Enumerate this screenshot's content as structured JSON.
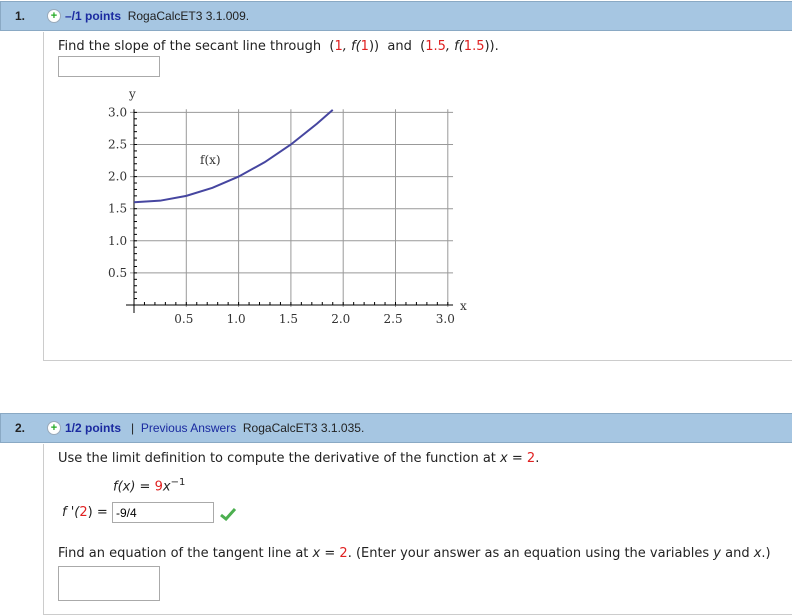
{
  "q1": {
    "number": "1.",
    "points": "–/1 points",
    "code": "RogaCalcET3 3.1.009.",
    "prompt": "Find the slope of the secant line through",
    "p1_open": "(",
    "p1_x": "1",
    "p1_mid": ", f(",
    "p1_arg": "1",
    "p1_close": "))",
    "and": "and",
    "p2_open": "(",
    "p2_x": "1.5",
    "p2_mid": ", f(",
    "p2_arg": "1.5",
    "p2_close": ")).",
    "answer": ""
  },
  "chart_data": {
    "type": "line",
    "title": "",
    "xlabel": "x",
    "ylabel": "y",
    "xlim": [
      0,
      3.1
    ],
    "ylim": [
      0,
      3.1
    ],
    "xticks": [
      "0.5",
      "1.0",
      "1.5",
      "2.0",
      "2.5",
      "3.0"
    ],
    "yticks": [
      "0.5",
      "1.0",
      "1.5",
      "2.0",
      "2.5",
      "3.0"
    ],
    "grid": true,
    "curve_label": "f(x)",
    "series": [
      {
        "name": "f(x)",
        "color": "#4040a0",
        "x": [
          0,
          0.25,
          0.5,
          0.75,
          1.0,
          1.25,
          1.5,
          1.75,
          1.9
        ],
        "y": [
          1.6,
          1.625,
          1.7,
          1.825,
          2.0,
          2.225,
          2.5,
          2.825,
          3.04
        ]
      }
    ]
  },
  "q2": {
    "number": "2.",
    "points": "1/2 points",
    "sep": "|",
    "prev": "Previous Answers",
    "code": "RogaCalcET3 3.1.035.",
    "prompt1_a": "Use the limit definition to compute the derivative of the function at ",
    "prompt1_var": "x",
    "prompt1_eq": " = ",
    "prompt1_val": "2",
    "prompt1_end": ".",
    "func_lhs": "f(x) = ",
    "func_coef": "9",
    "func_var": "x",
    "func_exp": "−1",
    "deriv_lhs": "f '(",
    "deriv_arg": "2",
    "deriv_rhs": ") = ",
    "deriv_answer": "-9/4",
    "prompt2_a": "Find an equation of the tangent line at ",
    "prompt2_var": "x",
    "prompt2_eq": " = ",
    "prompt2_val": "2",
    "prompt2_b": ".  (Enter your answer as an equation using the variables ",
    "prompt2_y": "y",
    "prompt2_and": " and ",
    "prompt2_x": "x",
    "prompt2_end": ".)",
    "answer": ""
  }
}
